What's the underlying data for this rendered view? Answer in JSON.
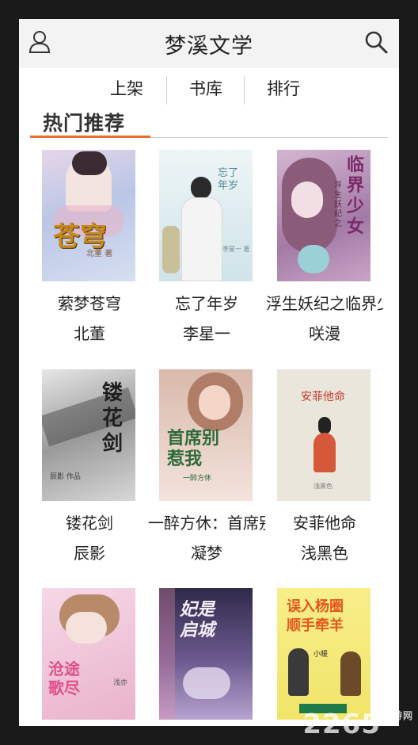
{
  "header": {
    "title": "梦溪文学"
  },
  "tabs": [
    {
      "label": "上架"
    },
    {
      "label": "书库"
    },
    {
      "label": "排行"
    }
  ],
  "section": {
    "title": "热门推荐"
  },
  "books": [
    {
      "title": "萦梦苍穹",
      "author": "北董",
      "cover_text": "苍穹",
      "cover_sub": "北董 著",
      "cover_color": "#c7d3ea"
    },
    {
      "title": "忘了年岁",
      "author": "李星一",
      "cover_text": "忘了年岁",
      "cover_sub": "李星一 著",
      "cover_color": "#e6f0f4"
    },
    {
      "title": "浮生妖纪之临界少女",
      "author": "咲漫",
      "cover_text": "临界少女",
      "cover_sub": "浮生妖纪之",
      "cover_color": "#c8a5c8"
    },
    {
      "title": "镂花剑",
      "author": "辰影",
      "cover_text": "镂花剑",
      "cover_sub": "辰影 作品",
      "cover_color": "#bfbfbf"
    },
    {
      "title": "一醉方休：首席别惹我",
      "author": "凝梦",
      "cover_text": "首席别惹我",
      "cover_sub": "一醉方休",
      "cover_color": "#ead7cf"
    },
    {
      "title": "安菲他命",
      "author": "浅黑色",
      "cover_text": "安菲他命",
      "cover_sub": "浅黑色",
      "cover_color": "#e9e4da"
    },
    {
      "title": "",
      "author": "",
      "cover_text": "沧途歌尽",
      "cover_sub": "浅亦",
      "cover_color": "#f1cfe0"
    },
    {
      "title": "",
      "author": "",
      "cover_text": "妃是启城",
      "cover_sub": "",
      "cover_color": "#5b4a7a"
    },
    {
      "title": "",
      "author": "",
      "cover_text": "误入杨圈 顺手牵羊",
      "cover_sub": "小暖",
      "cover_color": "#f5ea7a"
    }
  ],
  "watermark": {
    "text": "2265",
    "sub": "手游网"
  }
}
